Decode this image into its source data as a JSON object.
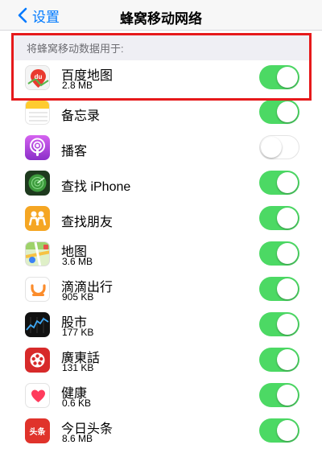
{
  "nav": {
    "back_label": "设置",
    "title": "蜂窝移动网络"
  },
  "section": {
    "header": "将蜂窝移动数据用于:"
  },
  "apps": [
    {
      "name": "百度地图",
      "size": "2.8 MB",
      "enabled": true,
      "icon": "baidu-maps-icon"
    },
    {
      "name": "备忘录",
      "size": "",
      "enabled": true,
      "icon": "notes-icon"
    },
    {
      "name": "播客",
      "size": "",
      "enabled": false,
      "icon": "podcasts-icon"
    },
    {
      "name": "查找 iPhone",
      "size": "",
      "enabled": true,
      "icon": "find-iphone-icon"
    },
    {
      "name": "查找朋友",
      "size": "",
      "enabled": true,
      "icon": "find-friends-icon"
    },
    {
      "name": "地图",
      "size": "3.6 MB",
      "enabled": true,
      "icon": "maps-icon"
    },
    {
      "name": "滴滴出行",
      "size": "905 KB",
      "enabled": true,
      "icon": "didi-icon"
    },
    {
      "name": "股市",
      "size": "177 KB",
      "enabled": true,
      "icon": "stocks-icon"
    },
    {
      "name": "廣東話",
      "size": "131 KB",
      "enabled": true,
      "icon": "cantonese-icon"
    },
    {
      "name": "健康",
      "size": "0.6 KB",
      "enabled": true,
      "icon": "health-icon"
    },
    {
      "name": "今日头条",
      "size": "8.6 MB",
      "enabled": true,
      "icon": "toutiao-icon"
    }
  ],
  "icon_text": {
    "baidu": "du",
    "toutiao": "头条"
  },
  "colors": {
    "accent": "#007aff",
    "toggle_on": "#4cd964",
    "highlight": "#e6191b"
  }
}
